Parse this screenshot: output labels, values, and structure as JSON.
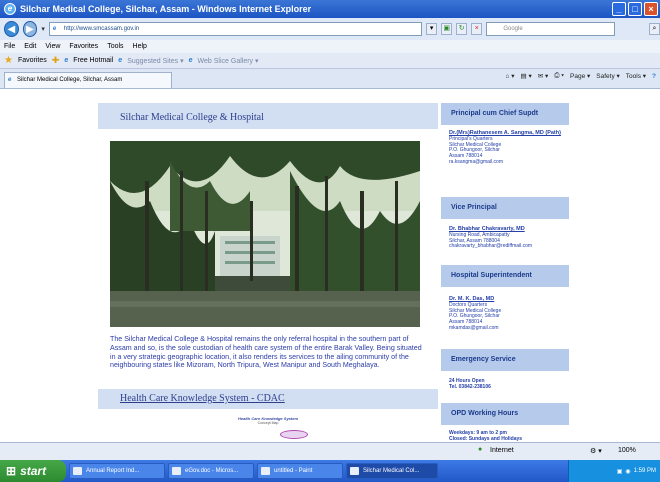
{
  "window": {
    "title": "Silchar Medical College, Silchar, Assam - Windows Internet Explorer"
  },
  "address": {
    "url": "http://www.smcassam.gov.in",
    "search_placeholder": "Google"
  },
  "menu": [
    "File",
    "Edit",
    "View",
    "Favorites",
    "Tools",
    "Help"
  ],
  "favorites": {
    "label": "Favorites",
    "items": [
      "Free Hotmail",
      "Suggested Sites ▾",
      "Web Slice Gallery ▾"
    ]
  },
  "tab": {
    "label": "Silchar Medical College, Silchar, Assam"
  },
  "command_bar": [
    "Page ▾",
    "Safety ▾",
    "Tools ▾"
  ],
  "main": {
    "title": "Silchar Medical College & Hospital",
    "description": "The Silchar Medical College & Hospital remains the only referral hospital in the southern part of Assam and so, is the sole custodian of health care system of the entire Barak Valley. Being situated in a very strategic geographic location, it also renders its services to the ailing community of the neighbouring states like Mizoram, North Tripura, West Manipur and South Meghalaya.",
    "section_title": "Health Care Knowledge System - CDAC",
    "cdac_line1": "Health Care Knowledge System",
    "cdac_line2": "Concept Map"
  },
  "sidebar": {
    "principal": {
      "heading": "Principal cum Chief Supdt",
      "name": "Dr.(Mrs)Rathanesem A. Sangma, MD (Path)",
      "lines": [
        "Principal's Quarters",
        "Silchar Medical College",
        "P.O. Ghungoor, Silchar",
        "Assam 788014",
        "ra.ksangma@gmail.com"
      ]
    },
    "vice": {
      "heading": "Vice Principal",
      "name": "Dr. Bhabhar Chakravarty, MD",
      "lines": [
        "Nursing Road, Ambicapatty",
        "Silchar, Assam 788004",
        "chakravarty_bhabhar@rediffmail.com"
      ]
    },
    "supdt": {
      "heading": "Hospital Superintendent",
      "name": "Dr. M. K. Das, MD",
      "lines": [
        "Doctors Quarters",
        "Silchar Medical College",
        "P.O. Ghungoor, Silchar",
        "Assam 788014",
        "mkamdas@gmail.com"
      ]
    },
    "emergency": {
      "heading": "Emergency Service",
      "lines": [
        "24 Hours Open",
        "Tel. 03842-238106"
      ]
    },
    "opd": {
      "heading": "OPD Working Hours",
      "lines": [
        "Weekdays: 9 am to 2 pm",
        "Closed: Sundays and Holidays"
      ]
    }
  },
  "status": {
    "zone": "Internet",
    "zoom": "100%"
  },
  "taskbar": {
    "start": "start",
    "items": [
      "Annual Report Ind...",
      "eGov.doc - Micros...",
      "untitled - Paint",
      "Silchar Medical Col..."
    ],
    "time": "1:59 PM"
  }
}
